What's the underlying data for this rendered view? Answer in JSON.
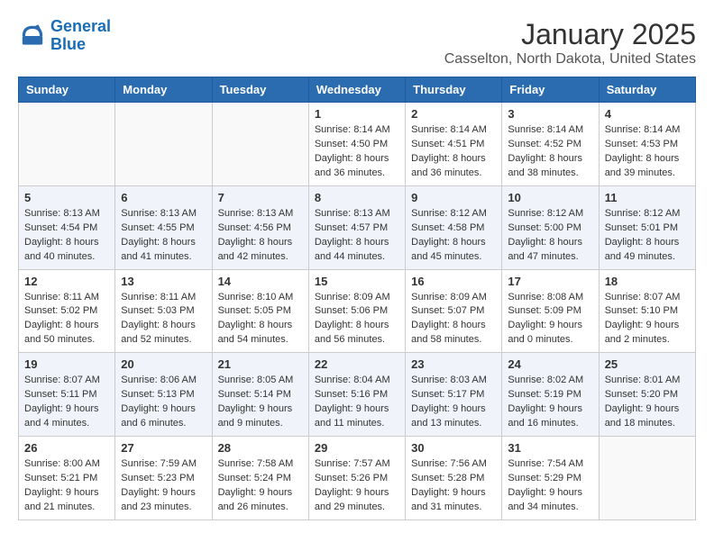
{
  "header": {
    "logo_line1": "General",
    "logo_line2": "Blue",
    "month": "January 2025",
    "location": "Casselton, North Dakota, United States"
  },
  "weekdays": [
    "Sunday",
    "Monday",
    "Tuesday",
    "Wednesday",
    "Thursday",
    "Friday",
    "Saturday"
  ],
  "weeks": [
    [
      {
        "day": "",
        "info": ""
      },
      {
        "day": "",
        "info": ""
      },
      {
        "day": "",
        "info": ""
      },
      {
        "day": "1",
        "info": "Sunrise: 8:14 AM\nSunset: 4:50 PM\nDaylight: 8 hours and 36 minutes."
      },
      {
        "day": "2",
        "info": "Sunrise: 8:14 AM\nSunset: 4:51 PM\nDaylight: 8 hours and 36 minutes."
      },
      {
        "day": "3",
        "info": "Sunrise: 8:14 AM\nSunset: 4:52 PM\nDaylight: 8 hours and 38 minutes."
      },
      {
        "day": "4",
        "info": "Sunrise: 8:14 AM\nSunset: 4:53 PM\nDaylight: 8 hours and 39 minutes."
      }
    ],
    [
      {
        "day": "5",
        "info": "Sunrise: 8:13 AM\nSunset: 4:54 PM\nDaylight: 8 hours and 40 minutes."
      },
      {
        "day": "6",
        "info": "Sunrise: 8:13 AM\nSunset: 4:55 PM\nDaylight: 8 hours and 41 minutes."
      },
      {
        "day": "7",
        "info": "Sunrise: 8:13 AM\nSunset: 4:56 PM\nDaylight: 8 hours and 42 minutes."
      },
      {
        "day": "8",
        "info": "Sunrise: 8:13 AM\nSunset: 4:57 PM\nDaylight: 8 hours and 44 minutes."
      },
      {
        "day": "9",
        "info": "Sunrise: 8:12 AM\nSunset: 4:58 PM\nDaylight: 8 hours and 45 minutes."
      },
      {
        "day": "10",
        "info": "Sunrise: 8:12 AM\nSunset: 5:00 PM\nDaylight: 8 hours and 47 minutes."
      },
      {
        "day": "11",
        "info": "Sunrise: 8:12 AM\nSunset: 5:01 PM\nDaylight: 8 hours and 49 minutes."
      }
    ],
    [
      {
        "day": "12",
        "info": "Sunrise: 8:11 AM\nSunset: 5:02 PM\nDaylight: 8 hours and 50 minutes."
      },
      {
        "day": "13",
        "info": "Sunrise: 8:11 AM\nSunset: 5:03 PM\nDaylight: 8 hours and 52 minutes."
      },
      {
        "day": "14",
        "info": "Sunrise: 8:10 AM\nSunset: 5:05 PM\nDaylight: 8 hours and 54 minutes."
      },
      {
        "day": "15",
        "info": "Sunrise: 8:09 AM\nSunset: 5:06 PM\nDaylight: 8 hours and 56 minutes."
      },
      {
        "day": "16",
        "info": "Sunrise: 8:09 AM\nSunset: 5:07 PM\nDaylight: 8 hours and 58 minutes."
      },
      {
        "day": "17",
        "info": "Sunrise: 8:08 AM\nSunset: 5:09 PM\nDaylight: 9 hours and 0 minutes."
      },
      {
        "day": "18",
        "info": "Sunrise: 8:07 AM\nSunset: 5:10 PM\nDaylight: 9 hours and 2 minutes."
      }
    ],
    [
      {
        "day": "19",
        "info": "Sunrise: 8:07 AM\nSunset: 5:11 PM\nDaylight: 9 hours and 4 minutes."
      },
      {
        "day": "20",
        "info": "Sunrise: 8:06 AM\nSunset: 5:13 PM\nDaylight: 9 hours and 6 minutes."
      },
      {
        "day": "21",
        "info": "Sunrise: 8:05 AM\nSunset: 5:14 PM\nDaylight: 9 hours and 9 minutes."
      },
      {
        "day": "22",
        "info": "Sunrise: 8:04 AM\nSunset: 5:16 PM\nDaylight: 9 hours and 11 minutes."
      },
      {
        "day": "23",
        "info": "Sunrise: 8:03 AM\nSunset: 5:17 PM\nDaylight: 9 hours and 13 minutes."
      },
      {
        "day": "24",
        "info": "Sunrise: 8:02 AM\nSunset: 5:19 PM\nDaylight: 9 hours and 16 minutes."
      },
      {
        "day": "25",
        "info": "Sunrise: 8:01 AM\nSunset: 5:20 PM\nDaylight: 9 hours and 18 minutes."
      }
    ],
    [
      {
        "day": "26",
        "info": "Sunrise: 8:00 AM\nSunset: 5:21 PM\nDaylight: 9 hours and 21 minutes."
      },
      {
        "day": "27",
        "info": "Sunrise: 7:59 AM\nSunset: 5:23 PM\nDaylight: 9 hours and 23 minutes."
      },
      {
        "day": "28",
        "info": "Sunrise: 7:58 AM\nSunset: 5:24 PM\nDaylight: 9 hours and 26 minutes."
      },
      {
        "day": "29",
        "info": "Sunrise: 7:57 AM\nSunset: 5:26 PM\nDaylight: 9 hours and 29 minutes."
      },
      {
        "day": "30",
        "info": "Sunrise: 7:56 AM\nSunset: 5:28 PM\nDaylight: 9 hours and 31 minutes."
      },
      {
        "day": "31",
        "info": "Sunrise: 7:54 AM\nSunset: 5:29 PM\nDaylight: 9 hours and 34 minutes."
      },
      {
        "day": "",
        "info": ""
      }
    ]
  ]
}
